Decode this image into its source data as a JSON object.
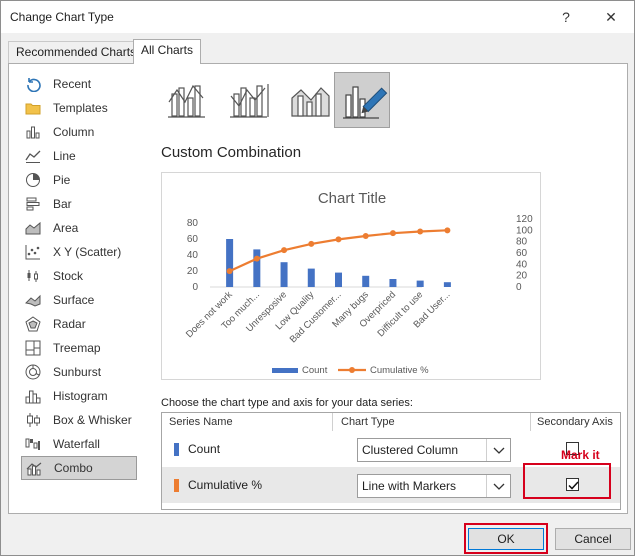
{
  "window": {
    "title": "Change Chart Type",
    "help": "?",
    "close": "✕"
  },
  "tabs": [
    {
      "label": "Recommended Charts",
      "active": false
    },
    {
      "label": "All Charts",
      "active": true
    }
  ],
  "sidebar": {
    "items": [
      {
        "label": "Recent",
        "icon": "recent-icon"
      },
      {
        "label": "Templates",
        "icon": "folder-icon"
      },
      {
        "label": "Column",
        "icon": "column-chart-icon"
      },
      {
        "label": "Line",
        "icon": "line-chart-icon"
      },
      {
        "label": "Pie",
        "icon": "pie-chart-icon"
      },
      {
        "label": "Bar",
        "icon": "bar-chart-icon"
      },
      {
        "label": "Area",
        "icon": "area-chart-icon"
      },
      {
        "label": "X Y (Scatter)",
        "icon": "scatter-chart-icon"
      },
      {
        "label": "Stock",
        "icon": "stock-chart-icon"
      },
      {
        "label": "Surface",
        "icon": "surface-chart-icon"
      },
      {
        "label": "Radar",
        "icon": "radar-chart-icon"
      },
      {
        "label": "Treemap",
        "icon": "treemap-chart-icon"
      },
      {
        "label": "Sunburst",
        "icon": "sunburst-chart-icon"
      },
      {
        "label": "Histogram",
        "icon": "histogram-chart-icon"
      },
      {
        "label": "Box & Whisker",
        "icon": "box-whisker-chart-icon"
      },
      {
        "label": "Waterfall",
        "icon": "waterfall-chart-icon"
      },
      {
        "label": "Combo",
        "icon": "combo-chart-icon",
        "selected": true
      }
    ]
  },
  "subtypes": [
    {
      "name": "clustered-column-line-icon",
      "selected": false
    },
    {
      "name": "clustered-column-line-secondary-icon",
      "selected": false
    },
    {
      "name": "stacked-area-column-icon",
      "selected": false
    },
    {
      "name": "custom-combination-icon",
      "selected": true
    }
  ],
  "section_title": "Custom Combination",
  "chart_data": {
    "type": "bar",
    "title": "Chart Title",
    "categories": [
      "Does not work",
      "Too much...",
      "Unresposive",
      "Low Quality",
      "Bad Customer...",
      "Many bugs",
      "Overpriced",
      "Difficult to use",
      "Bad User..."
    ],
    "series": [
      {
        "name": "Count",
        "type": "bar",
        "axis": "primary",
        "color": "#4472c4",
        "values": [
          60,
          47,
          31,
          23,
          18,
          14,
          10,
          8,
          6
        ]
      },
      {
        "name": "Cumulative %",
        "type": "line",
        "axis": "secondary",
        "color": "#ed7d31",
        "values": [
          28,
          50,
          65,
          76,
          84,
          90,
          95,
          98,
          100
        ]
      }
    ],
    "y_primary": {
      "min": 0,
      "max": 80,
      "ticks": [
        "80",
        "60",
        "40",
        "20",
        "0"
      ]
    },
    "y_secondary": {
      "min": 0,
      "max": 120,
      "ticks": [
        "120",
        "100",
        "80",
        "60",
        "40",
        "20",
        "0"
      ]
    },
    "legend": "bottom"
  },
  "series_section": {
    "heading": "Choose the chart type and axis for your data series:",
    "columns": [
      "Series Name",
      "Chart Type",
      "Secondary Axis"
    ],
    "rows": [
      {
        "name": "Count",
        "color": "#4472c4",
        "chart_type": "Clustered Column",
        "secondary": false
      },
      {
        "name": "Cumulative %",
        "color": "#ed7d31",
        "chart_type": "Line with Markers",
        "secondary": true
      }
    ]
  },
  "annotation": {
    "label": "Mark it"
  },
  "buttons": {
    "ok": "OK",
    "cancel": "Cancel"
  }
}
